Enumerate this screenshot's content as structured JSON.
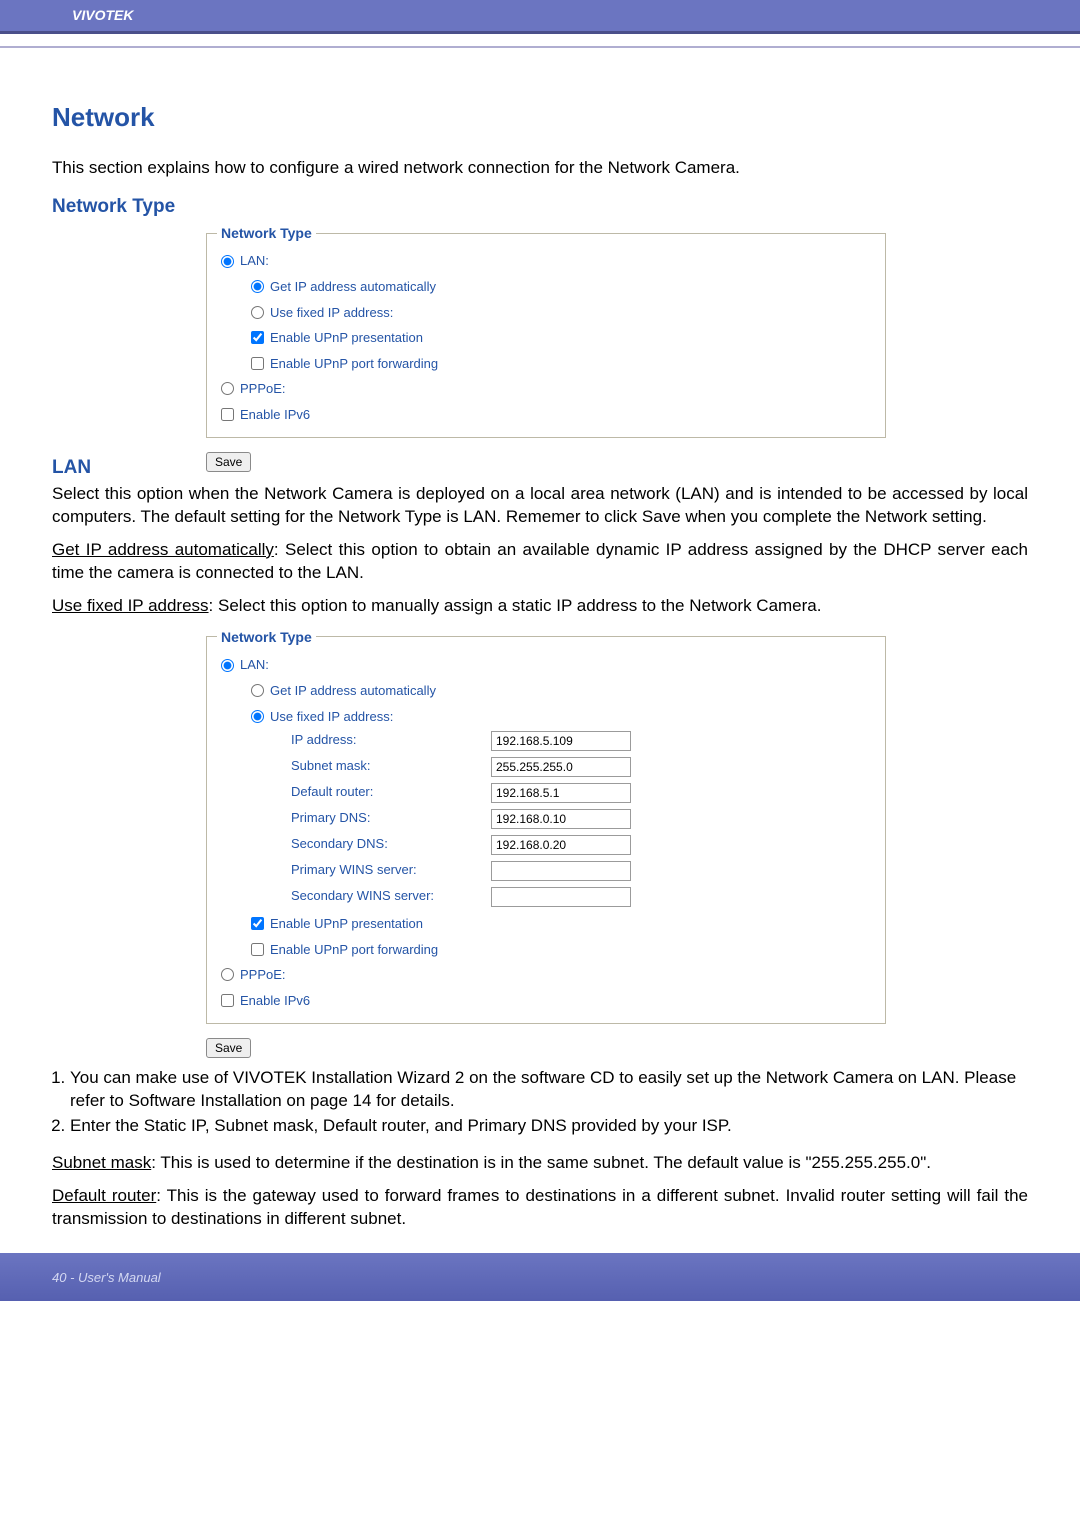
{
  "header": {
    "brand": "VIVOTEK"
  },
  "section": {
    "title": "Network",
    "intro": "This section explains how to configure a wired network connection for the Network Camera."
  },
  "network_type_heading": "Network Type",
  "panel1": {
    "legend": "Network Type",
    "lan_label": "LAN:",
    "get_ip": "Get IP address automatically",
    "use_fixed": "Use fixed IP address:",
    "upnp_pres": "Enable UPnP presentation",
    "upnp_port": "Enable UPnP port forwarding",
    "pppoe": "PPPoE:",
    "ipv6": "Enable IPv6",
    "save": "Save"
  },
  "lan_heading": "LAN",
  "lan_para": "Select this option when the Network Camera is deployed on a local area network (LAN) and is intended to be accessed by local computers. The default setting for the Network Type is LAN. Rememer to click Save when you complete the Network setting.",
  "get_ip_label": "Get IP address automatically",
  "get_ip_desc": ": Select this option to obtain an available dynamic IP address assigned by the DHCP server each time the camera is connected to the LAN.",
  "use_fixed_label": "Use fixed IP address",
  "use_fixed_desc": ": Select this option to manually assign a static IP address to the Network Camera.",
  "panel2": {
    "legend": "Network Type",
    "lan_label": "LAN:",
    "get_ip": "Get IP address automatically",
    "use_fixed": "Use fixed IP address:",
    "fields": {
      "ip_label": "IP address:",
      "ip_val": "192.168.5.109",
      "mask_label": "Subnet mask:",
      "mask_val": "255.255.255.0",
      "router_label": "Default router:",
      "router_val": "192.168.5.1",
      "pdns_label": "Primary DNS:",
      "pdns_val": "192.168.0.10",
      "sdns_label": "Secondary DNS:",
      "sdns_val": "192.168.0.20",
      "pwins_label": "Primary WINS server:",
      "pwins_val": "",
      "swins_label": "Secondary WINS server:",
      "swins_val": ""
    },
    "upnp_pres": "Enable UPnP presentation",
    "upnp_port": "Enable UPnP port forwarding",
    "pppoe": "PPPoE:",
    "ipv6": "Enable IPv6",
    "save": "Save"
  },
  "notes": {
    "n1": "You can make use of VIVOTEK Installation Wizard 2 on the software CD to easily set up the Network Camera on LAN. Please refer to Software Installation on page 14 for details.",
    "n2": "Enter the Static IP, Subnet mask, Default router, and Primary DNS provided by your ISP."
  },
  "subnet_label": "Subnet mask",
  "subnet_desc": ": This is used to determine if the destination is in the same subnet. The default value is \"255.255.255.0\".",
  "defroute_label": "Default router",
  "defroute_desc": ": This is the gateway used to forward frames to destinations in a different subnet. Invalid router setting will fail the transmission to destinations in different subnet.",
  "footer": {
    "page": "40 - User's Manual"
  }
}
